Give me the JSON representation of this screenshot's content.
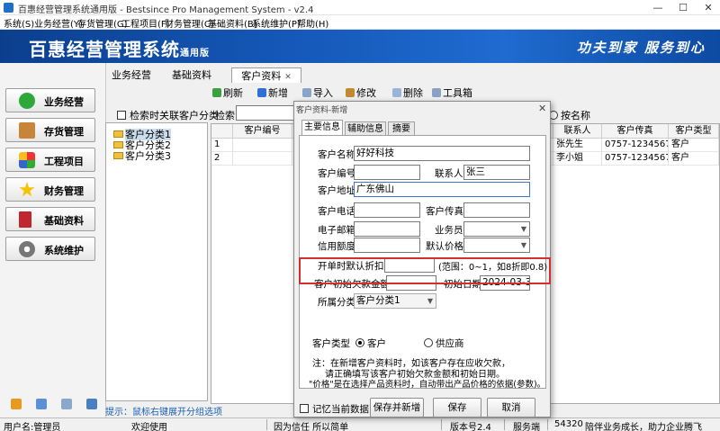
{
  "window": {
    "title": "百惠经营管理系统通用版 - Bestsince Pro Management System - v2.4",
    "controls": {
      "minimize": "—",
      "maximize": "☐",
      "close": "✕"
    }
  },
  "menu": [
    "系统(S)",
    "业务经营(Y)",
    "存货管理(G)",
    "工程项目(F)",
    "财务管理(C)",
    "基础资料(B)",
    "系统维护(P)",
    "帮助(H)"
  ],
  "banner": {
    "title": "百惠经营管理系统",
    "edition": "通用版",
    "slogan": "功夫到家  服务到心"
  },
  "nav": [
    "业务经营",
    "存货管理",
    "工程项目",
    "财务管理",
    "基础资料",
    "系统维护"
  ],
  "main_tabs": [
    "业务经营",
    "基础资料",
    "客户资料"
  ],
  "tab_close": "✕",
  "toolbar": [
    "刷新",
    "新增",
    "导入",
    "修改",
    "删除",
    "工具箱"
  ],
  "category": {
    "check_label": "检索时关联客户分类",
    "nodes": [
      "客户分类1",
      "客户分类2",
      "客户分类3"
    ]
  },
  "tip": "提示：鼠标右键展开分组选项",
  "grid": {
    "search_label": "检索",
    "radio_label": "按名称",
    "headers": [
      "",
      "客户编号",
      "",
      "联系人",
      "客户传真",
      "客户类型"
    ],
    "rows": [
      {
        "num": "1",
        "code": "",
        "name": "广",
        "contact": "张先生",
        "fax": "0757-12345678",
        "type": "客户"
      },
      {
        "num": "2",
        "code": "",
        "name": "上",
        "contact": "李小姐",
        "fax": "0757-12345676",
        "type": "客户"
      }
    ]
  },
  "status": {
    "user": "用户名:管理员",
    "welcome": "欢迎使用",
    "motto": "因为信任  所以简单",
    "version": "版本号2.4",
    "server_label": "服务端",
    "port": "54320",
    "slogan": "陪伴业务成长，助力企业腾飞"
  },
  "dialog": {
    "title": "客户资料-新增",
    "close": "✕",
    "tabs": [
      "主要信息",
      "辅助信息",
      "摘要"
    ],
    "labels": {
      "name": "客户名称",
      "code": "客户编号",
      "contact": "联系人",
      "address": "客户地址",
      "phone": "客户电话",
      "fax": "客户传真",
      "email": "电子邮箱",
      "salesman": "业务员",
      "credit": "信用额度",
      "default_price": "默认价格",
      "discount": "开单时默认折扣率",
      "initial_debt": "客户初始欠款金额",
      "initial_date": "初始日期",
      "category": "所属分类",
      "ctype": "客户类型"
    },
    "values": {
      "name": "好好科技",
      "code": "",
      "contact": "张三",
      "address": "广东佛山",
      "phone": "",
      "fax": "",
      "email": "",
      "salesman": "",
      "credit": "",
      "default_price": "",
      "discount": "",
      "discount_hint": "(范围：0~1，如8折即0.8)",
      "initial_debt": "",
      "initial_date": "2024-03-31",
      "category": "客户分类1"
    },
    "ctype_options": [
      "客户",
      "供应商"
    ],
    "note": [
      "注：在新增客户资料时，如该客户存在应收欠款，",
      "请正确填写该客户初始欠款金额和初始日期。",
      "\"价格\"是在选择产品资料时，自动带出产品价格的依据(参数)。"
    ],
    "remember_label": "记忆当前数据",
    "buttons": [
      "保存并新增",
      "保存",
      "取消"
    ]
  },
  "icons": {
    "nav": [
      "check-circle-icon",
      "box-icon",
      "puzzle-icon",
      "star-icon",
      "book-icon",
      "gear-icon"
    ],
    "toolbar": [
      "refresh-icon",
      "add-icon",
      "import-icon",
      "edit-icon",
      "delete-icon",
      "toolbox-icon"
    ]
  },
  "colors": {
    "banner": "#1558b8",
    "highlight": "#d03030",
    "tip": "#1a5fb4"
  }
}
